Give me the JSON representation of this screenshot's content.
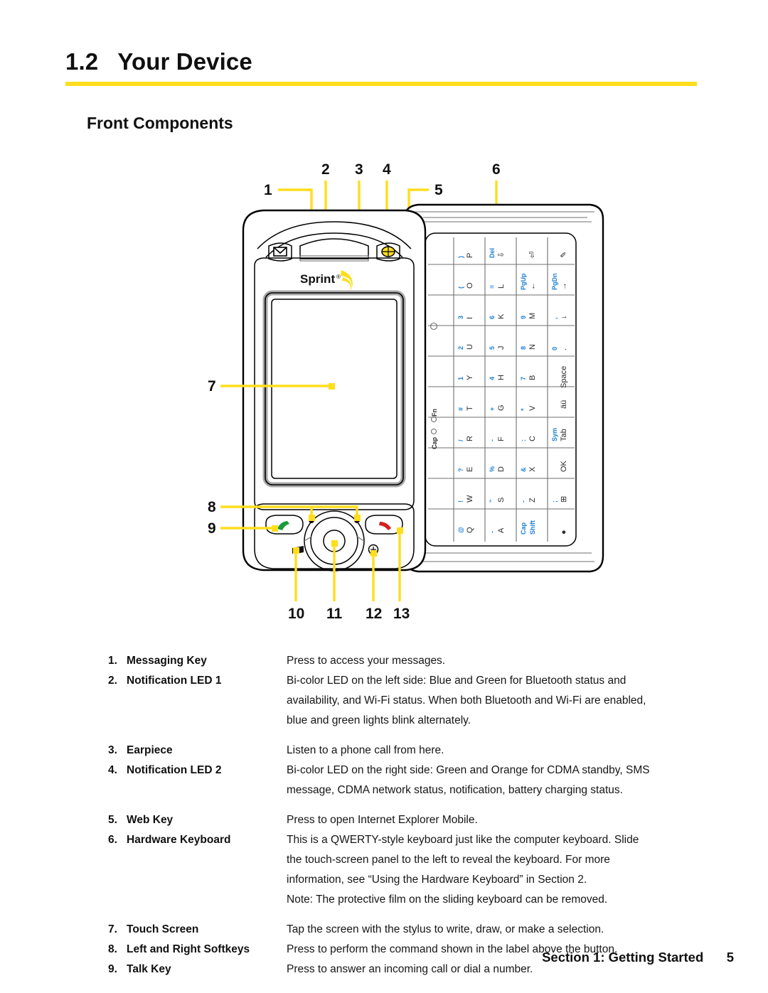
{
  "header": {
    "number": "1.2",
    "title": "Your Device",
    "title_full": "1.2   Your Device",
    "rule_color": "#ffdd1c",
    "section_heading": "Front Components"
  },
  "diagram": {
    "name": "front-components-illustration",
    "brand": "Sprint",
    "callout_color": "#ffdd1c",
    "callouts_top": [
      "1",
      "2",
      "3",
      "4",
      "5",
      "6"
    ],
    "callouts_left": [
      "7",
      "8",
      "9"
    ],
    "callouts_bottom": [
      "10",
      "11",
      "12",
      "13"
    ],
    "icons": {
      "messaging": "envelope-icon",
      "web": "globe-icon",
      "talk": "green-phone-icon",
      "end": "red-phone-icon",
      "start": "windows-flag-icon",
      "ok": "ok-button-icon"
    },
    "keyboard": {
      "indicator_cap": "Cap",
      "indicator_fn": "Fn",
      "rows": [
        [
          "",
          "P\n)",
          "Del",
          "⏎",
          "✎"
        ],
        [
          "",
          "O\n(",
          "L\n=",
          "PgUp",
          "PgDn"
        ],
        [
          "",
          "I\n3",
          "K\n6",
          "M\n9",
          "↓"
        ],
        [
          "",
          "U\n2",
          "J\n5",
          "N\n8",
          "0\n."
        ],
        [
          "",
          "Y\n1",
          "H\n4",
          "B\n7",
          "Space"
        ],
        [
          "",
          "T\n#",
          "G\n+",
          "V\n*",
          "äü"
        ],
        [
          "",
          "R\n/",
          "F\n-",
          "C\n:",
          "Tab\nSym"
        ],
        [
          "",
          "E\n?",
          "D\n%",
          "X\n&",
          "OK"
        ],
        [
          "",
          "W\n!",
          "S\n\"",
          "Z\n-",
          "⊞"
        ],
        [
          "",
          "Q\n@",
          "A\n-",
          "Shift\nCap",
          "●"
        ]
      ]
    }
  },
  "components": [
    {
      "num": "1.",
      "label": "Messaging Key",
      "desc": [
        "Press to access your messages."
      ],
      "gap_before": false
    },
    {
      "num": "2.",
      "label": "Notification LED 1",
      "desc": [
        "Bi-color LED on the left side: Blue and Green for Bluetooth status and",
        "availability, and Wi-Fi status. When both Bluetooth and Wi-Fi are enabled,",
        "blue and green lights blink alternately."
      ],
      "gap_before": false
    },
    {
      "num": "3.",
      "label": "Earpiece",
      "desc": [
        "Listen to a phone call from here."
      ],
      "gap_before": true
    },
    {
      "num": "4.",
      "label": "Notification LED 2",
      "desc": [
        "Bi-color LED on the right side: Green and Orange for CDMA standby, SMS",
        "message, CDMA network status, notification, battery charging status."
      ],
      "gap_before": false
    },
    {
      "num": "5.",
      "label": "Web Key",
      "desc": [
        "Press to open Internet Explorer Mobile."
      ],
      "gap_before": true
    },
    {
      "num": "6.",
      "label": "Hardware Keyboard",
      "desc": [
        "This is a QWERTY-style keyboard just like the computer keyboard. Slide",
        "the touch-screen panel to the left to reveal the keyboard. For more",
        "information, see “Using the Hardware Keyboard” in Section 2.",
        "Note: The protective film on the sliding keyboard can be removed."
      ],
      "gap_before": false
    },
    {
      "num": "7.",
      "label": "Touch Screen",
      "desc": [
        "Tap the screen with the stylus to write, draw, or make a selection."
      ],
      "gap_before": true
    },
    {
      "num": "8.",
      "label": "Left and Right Softkeys",
      "desc": [
        "Press to perform the command shown in the label above the button."
      ],
      "gap_before": false
    },
    {
      "num": "9.",
      "label": "Talk Key",
      "desc": [
        "Press to answer an incoming call or dial a number."
      ],
      "gap_before": false
    }
  ],
  "footer": {
    "section": "Section 1: Getting Started",
    "page": "5"
  }
}
